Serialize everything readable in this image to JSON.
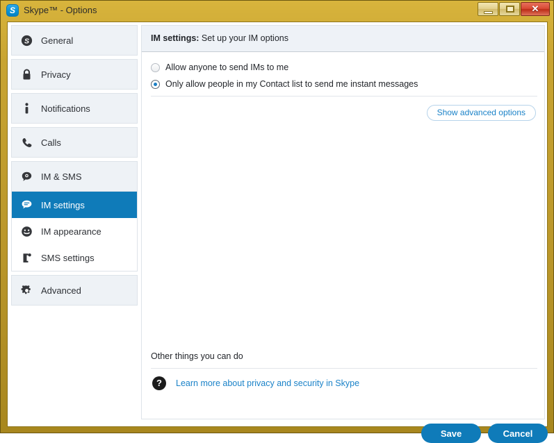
{
  "window": {
    "title": "Skype™ - Options",
    "logo_icon": "skype-logo-icon",
    "controls": {
      "minimize": "minimize-icon",
      "maximize": "maximize-icon",
      "close": "✕"
    },
    "accent_color": "#0f7bb9",
    "frame_color": "#b9962a",
    "link_color": "#1a82c8"
  },
  "sidebar": {
    "groups": [
      {
        "items": [
          {
            "label": "General",
            "icon": "skype-icon",
            "selected": false
          }
        ]
      },
      {
        "items": [
          {
            "label": "Privacy",
            "icon": "lock-icon",
            "selected": false
          }
        ]
      },
      {
        "items": [
          {
            "label": "Notifications",
            "icon": "info-icon",
            "selected": false
          }
        ]
      },
      {
        "items": [
          {
            "label": "Calls",
            "icon": "phone-icon",
            "selected": false
          }
        ]
      },
      {
        "items": [
          {
            "label": "IM & SMS",
            "icon": "chat-gear-icon",
            "selected": false
          }
        ]
      },
      {
        "sub": true,
        "items": [
          {
            "label": "IM settings",
            "icon": "chat-bubble-icon",
            "selected": true
          },
          {
            "label": "IM appearance",
            "icon": "smiley-icon",
            "selected": false
          },
          {
            "label": "SMS settings",
            "icon": "sms-phone-icon",
            "selected": false
          }
        ]
      },
      {
        "items": [
          {
            "label": "Advanced",
            "icon": "gear-icon",
            "selected": false
          }
        ]
      }
    ]
  },
  "content": {
    "header_bold": "IM settings:",
    "header_rest": " Set up your IM options",
    "radios": [
      {
        "label": "Allow anyone to send IMs to me",
        "selected": false
      },
      {
        "label": "Only allow people in my Contact list to send me instant messages",
        "selected": true
      }
    ],
    "advanced_button": "Show advanced options",
    "other_things_label": "Other things you can do",
    "help_icon": "?",
    "help_link": "Learn more about privacy and security in Skype"
  },
  "footer": {
    "save_label": "Save",
    "cancel_label": "Cancel"
  }
}
